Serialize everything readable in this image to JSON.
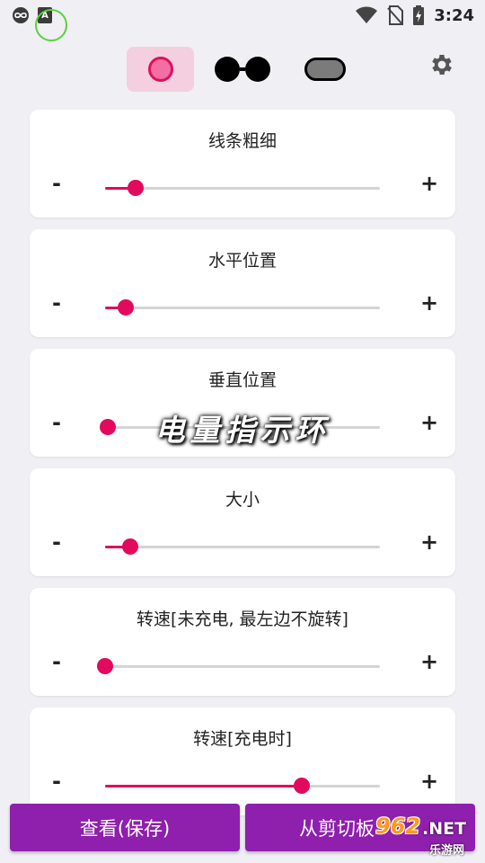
{
  "status_bar": {
    "time": "3:24",
    "icons": [
      "infinity-icon",
      "app-a-icon",
      "wifi-icon",
      "no-sim-icon",
      "battery-charging-icon"
    ],
    "app_badge": "A"
  },
  "mode_bar": {
    "modes": [
      "circle-ring-icon",
      "dual-dot-icon",
      "pill-icon"
    ],
    "selected": "circle-ring-icon",
    "accent": "#e0105e"
  },
  "cards": [
    {
      "title": "线条粗细",
      "minus": "-",
      "plus": "+",
      "value": 0.11
    },
    {
      "title": "水平位置",
      "minus": "-",
      "plus": "+",
      "value": 0.075
    },
    {
      "title": "垂直位置",
      "minus": "-",
      "plus": "+",
      "value": 0.01
    },
    {
      "title": "大小",
      "minus": "-",
      "plus": "+",
      "value": 0.09
    },
    {
      "title": "转速[未充电, 最左边不旋转]",
      "minus": "-",
      "plus": "+",
      "value": 0.0
    },
    {
      "title": "转速[充电时]",
      "minus": "-",
      "plus": "+",
      "value": 0.715
    }
  ],
  "overlay_text": "电量指示环",
  "bottom_buttons": {
    "view_save": "查看(保存)",
    "from_clipboard": "从剪切板"
  },
  "watermark": {
    "number": "962",
    "net": ".NET",
    "site": "乐游网"
  },
  "colors": {
    "background": "#f0eff4",
    "accent": "#e20a5d",
    "button": "#8f1fad"
  }
}
